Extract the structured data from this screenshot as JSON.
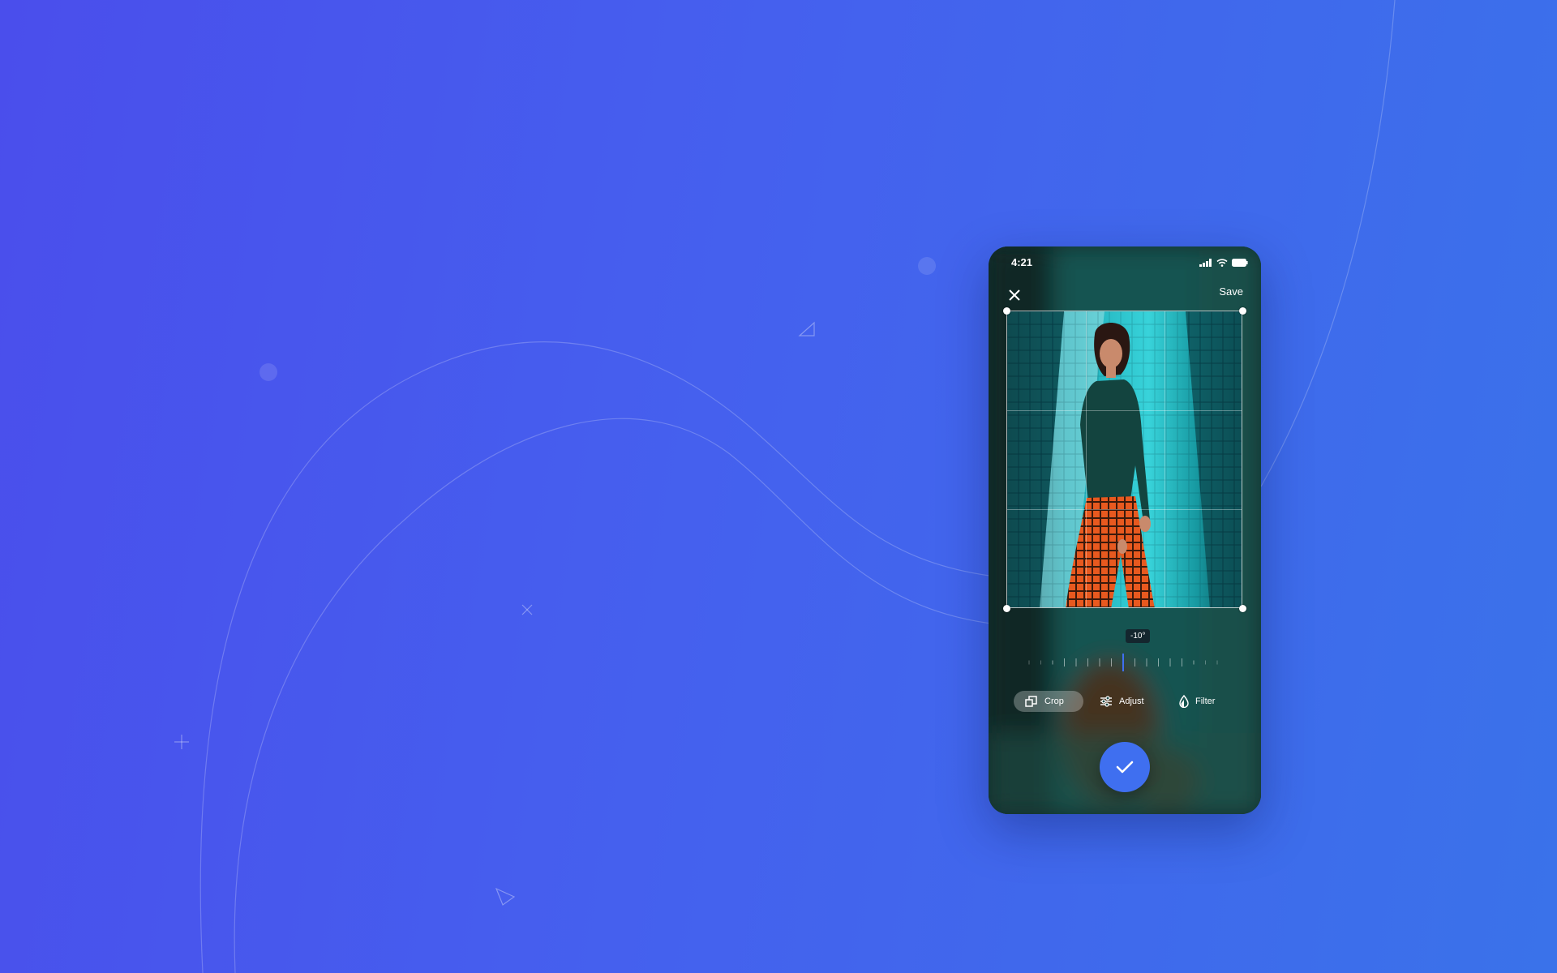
{
  "status_bar": {
    "time": "4:21",
    "icons": [
      "signal-icon",
      "wifi-icon",
      "battery-icon"
    ]
  },
  "header": {
    "close_icon": "close-icon",
    "save_label": "Save"
  },
  "rotation": {
    "angle_label": "-10°",
    "angle_value": -10
  },
  "tools": [
    {
      "label": "Crop",
      "icon": "crop-icon",
      "active": true
    },
    {
      "label": "Adjust",
      "icon": "sliders-icon",
      "active": false
    },
    {
      "label": "Filter",
      "icon": "drop-icon",
      "active": false
    }
  ],
  "confirm": {
    "icon": "check-icon"
  },
  "colors": {
    "background": "#4560ee",
    "accent": "#3f6ff0",
    "photo_teal": "#1fb6bd",
    "photo_orange": "#e8591f"
  }
}
